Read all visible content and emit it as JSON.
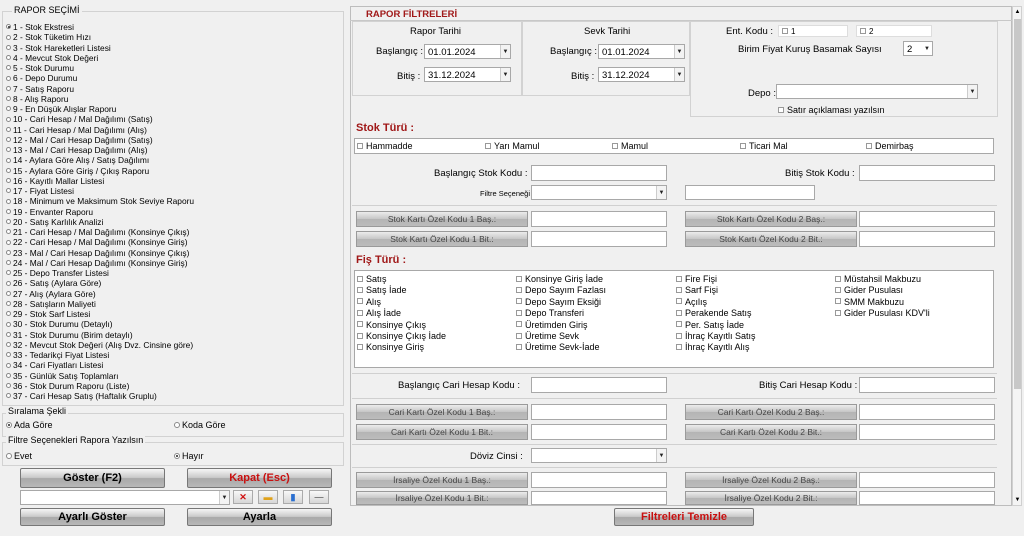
{
  "left": {
    "group_title": "RAPOR SEÇİMİ",
    "selected_index": 0,
    "reports": [
      "1 - Stok Ekstresi",
      "2 - Stok Tüketim Hızı",
      "3 - Stok Hareketleri Listesi",
      "4 - Mevcut Stok Değeri",
      "5 - Stok Durumu",
      "6 - Depo Durumu",
      "7 - Satış Raporu",
      "8 - Alış Raporu",
      "9 - En Düşük Alışlar Raporu",
      "10 - Cari Hesap / Mal Dağılımı (Satış)",
      "11 - Cari Hesap / Mal Dağılımı (Alış)",
      "12 - Mal / Cari Hesap Dağılımı (Satış)",
      "13 - Mal / Cari Hesap Dağılımı (Alış)",
      "14 - Aylara Göre Alış / Satış Dağılımı",
      "15 - Aylara Göre Giriş / Çıkış Raporu",
      "16 - Kayıtlı Mallar Listesi",
      "17 - Fiyat Listesi",
      "18 - Minimum ve Maksimum Stok Seviye Raporu",
      "19 - Envanter Raporu",
      "20 - Satış Karlılık Analizi",
      "21 - Cari Hesap / Mal Dağılımı (Konsinye Çıkış)",
      "22 - Cari Hesap / Mal Dağılımı (Konsinye Giriş)",
      "23 - Mal / Cari Hesap Dağılımı (Konsinye Çıkış)",
      "24 - Mal / Cari Hesap Dağılımı (Konsinye Giriş)",
      "25 - Depo Transfer Listesi",
      "26 - Satış (Aylara Göre)",
      "27 - Alış (Aylara Göre)",
      "28 - Satışların Maliyeti",
      "29 - Stok Sarf Listesi",
      "30 - Stok Durumu (Detaylı)",
      "31 - Stok Durumu (Birim detaylı)",
      "32 - Mevcut Stok Değeri (Alış Dvz. Cinsine göre)",
      "33 - Tedarikçi Fiyat Listesi",
      "34 - Cari Fiyatları Listesi",
      "35 - Günlük Satış Toplamları",
      "36 - Stok Durum Raporu (Liste)",
      "37 - Cari Hesap Satış (Haftalık Gruplu)"
    ],
    "sort_title": "Sıralama Şekli",
    "sort_options": [
      "Ada Göre",
      "Koda Göre"
    ],
    "filter_title": "Filtre Seçenekleri Rapora Yazılsın",
    "filter_options": [
      "Evet",
      "Hayır"
    ],
    "show_btn": "Göster (F2)",
    "close_btn": "Kapat (Esc)",
    "show_custom_btn": "Ayarlı Göster",
    "settings_btn": "Ayarla",
    "icon_x": "✕",
    "icon_folder": "▬",
    "icon_save": "▮",
    "icon_minus": "—"
  },
  "right": {
    "title": "RAPOR FİLTRELERİ",
    "rapor_tarihi": "Rapor Tarihi",
    "sevk_tarihi": "Sevk Tarihi",
    "baslangic": "Başlangıç :",
    "bitis": "Bitiş :",
    "rapor_bas": "01.01.2024",
    "rapor_bit": "31.12.2024",
    "sevk_bas": "01.01.2024",
    "sevk_bit": "31.12.2024",
    "ent_kodu": "Ent. Kodu :",
    "ent_opts": [
      "1",
      "2"
    ],
    "birim_fiyat": "Birim Fiyat Kuruş Basamak Sayısı",
    "birim_fiyat_val": "2",
    "depo": "Depo :",
    "satir_aciklama": "Satır açıklaması yazılsın",
    "stok_turu": "Stok Türü :",
    "stok_opts": [
      "Hammadde",
      "Yarı Mamul",
      "Mamul",
      "Ticari Mal",
      "Demirbaş"
    ],
    "bas_stok_kodu": "Başlangıç Stok Kodu :",
    "bit_stok_kodu": "Bitiş Stok Kodu :",
    "filtre_secenegi": "Filtre Seçeneği",
    "stok_ozel_1_bas": "Stok Kartı Özel Kodu 1 Baş.:",
    "stok_ozel_1_bit": "Stok Kartı Özel Kodu 1 Bit.:",
    "stok_ozel_2_bas": "Stok Kartı Özel Kodu 2 Baş.:",
    "stok_ozel_2_bit": "Stok Kartı Özel Kodu 2 Bit.:",
    "fis_turu": "Fiş Türü :",
    "fis_cols": [
      [
        "Satış",
        "Satış İade",
        "Alış",
        "Alış İade",
        "Konsinye Çıkış",
        "Konsinye Çıkış İade",
        "Konsinye Giriş"
      ],
      [
        "Konsinye Giriş İade",
        "Depo Sayım Fazlası",
        "Depo Sayım Eksiği",
        "Depo Transferi",
        "Üretimden Giriş",
        "Üretime Sevk",
        "Üretime Sevk-İade"
      ],
      [
        "Fire Fişi",
        "Sarf Fişi",
        "Açılış",
        "Perakende Satış",
        "Per. Satış İade",
        "İhraç Kayıtlı Satış",
        "İhraç Kayıtlı Alış"
      ],
      [
        "Müstahsil Makbuzu",
        "Gider Pusulası",
        "SMM Makbuzu",
        "Gider Pusulası KDV'li"
      ]
    ],
    "bas_cari": "Başlangıç Cari Hesap Kodu :",
    "bit_cari": "Bitiş Cari Hesap Kodu :",
    "cari_ozel_1_bas": "Cari Kartı Özel Kodu 1 Baş.:",
    "cari_ozel_1_bit": "Cari Kartı Özel Kodu 1 Bit.:",
    "cari_ozel_2_bas": "Cari Kartı Özel Kodu 2 Baş.:",
    "cari_ozel_2_bit": "Cari Kartı Özel Kodu 2 Bit.:",
    "doviz_cinsi": "Döviz Cinsi :",
    "irs_ozel_1_bas": "İrsaliye Özel Kodu 1 Baş.:",
    "irs_ozel_1_bit": "İrsaliye Özel Kodu 1 Bit.:",
    "irs_ozel_2_bas": "İrsaliye Özel Kodu 2 Baş.:",
    "irs_ozel_2_bit": "İrsaliye Özel Kodu 2 Bit.:",
    "clear_btn": "Filtreleri Temizle",
    "dropdown_arrow": "▼",
    "scroll_up": "▲",
    "scroll_down": "▼"
  }
}
